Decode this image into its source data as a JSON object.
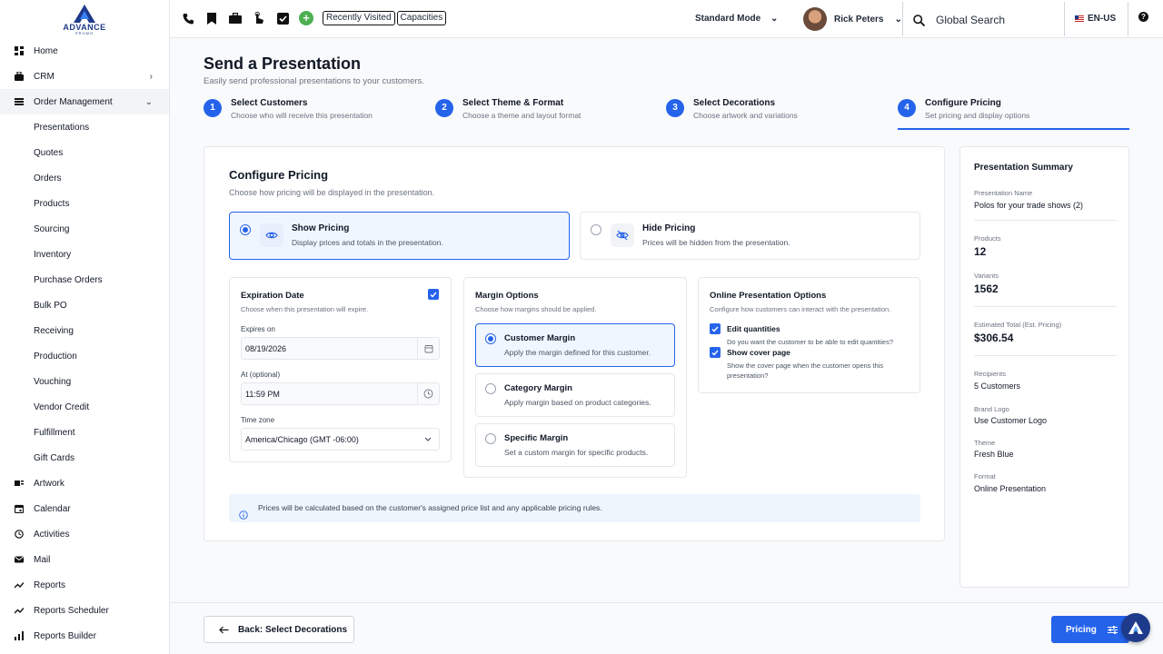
{
  "brand": {
    "logo_text": "ADVANCE",
    "logo_sub": "PROMO"
  },
  "sidebar": {
    "items": [
      {
        "label": "Home",
        "icon": "dashboard-icon"
      },
      {
        "label": "CRM",
        "icon": "briefcase-icon"
      },
      {
        "label": "Order Management",
        "icon": "list-icon"
      },
      {
        "label": "Presentations"
      },
      {
        "label": "Quotes"
      },
      {
        "label": "Orders"
      },
      {
        "label": "Products"
      },
      {
        "label": "Sourcing"
      },
      {
        "label": "Inventory"
      },
      {
        "label": "Purchase Orders"
      },
      {
        "label": "Bulk PO"
      },
      {
        "label": "Receiving"
      },
      {
        "label": "Production"
      },
      {
        "label": "Vouching"
      },
      {
        "label": "Vendor Credit"
      },
      {
        "label": "Fulfillment"
      },
      {
        "label": "Gift Cards"
      },
      {
        "label": "Artwork",
        "icon": "artwork-icon"
      },
      {
        "label": "Calendar",
        "icon": "calendar-icon"
      },
      {
        "label": "Activities",
        "icon": "clock-icon"
      },
      {
        "label": "Mail",
        "icon": "mail-icon"
      },
      {
        "label": "Reports",
        "icon": "trend-icon"
      },
      {
        "label": "Reports Scheduler",
        "icon": "trend-icon"
      },
      {
        "label": "Reports Builder",
        "icon": "bar-chart-icon"
      }
    ]
  },
  "topbar": {
    "recently_visited": "Recently Visited",
    "capacities": "Capacities",
    "mode": "Standard Mode",
    "user_name": "Rick Peters",
    "search_placeholder": "Global Search",
    "locale": "EN-US"
  },
  "page": {
    "title": "Send a Presentation",
    "subtitle": "Easily send professional presentations to your customers."
  },
  "steps": [
    {
      "num": "1",
      "title": "Select Customers",
      "desc": "Choose who will receive this presentation"
    },
    {
      "num": "2",
      "title": "Select Theme & Format",
      "desc": "Choose a theme and layout format"
    },
    {
      "num": "3",
      "title": "Select Decorations",
      "desc": "Choose artwork and variations"
    },
    {
      "num": "4",
      "title": "Configure Pricing",
      "desc": "Set pricing and display options"
    }
  ],
  "pricing": {
    "title": "Configure Pricing",
    "subtitle": "Choose how pricing will be displayed in the presentation.",
    "show": {
      "title": "Show Pricing",
      "desc": "Display prices and totals in the presentation.",
      "selected": true
    },
    "hide": {
      "title": "Hide Pricing",
      "desc": "Prices will be hidden from the presentation.",
      "selected": false
    }
  },
  "expiration": {
    "title": "Expiration Date",
    "desc": "Choose when this presentation will expire.",
    "enabled": true,
    "expires_label": "Expires on",
    "expires_value": "08/19/2026",
    "at_label": "At (optional)",
    "at_value": "11:59 PM",
    "tz_label": "Time zone",
    "tz_value": "America/Chicago (GMT -06:00)"
  },
  "margin": {
    "title": "Margin Options",
    "desc": "Choose how margins should be applied.",
    "options": [
      {
        "title": "Customer Margin",
        "desc": "Apply the margin defined for this customer.",
        "selected": true
      },
      {
        "title": "Category Margin",
        "desc": "Apply margin based on product categories.",
        "selected": false
      },
      {
        "title": "Specific Margin",
        "desc": "Set a custom margin for specific products.",
        "selected": false
      }
    ]
  },
  "online": {
    "title": "Online Presentation Options",
    "desc": "Configure how customers can interact with the presentation.",
    "edit_label": "Edit quantities",
    "edit_desc": "Do you want the customer to be able to edit quantities?",
    "edit_checked": true,
    "cover_label": "Show cover page",
    "cover_desc": "Show the cover page when the customer opens this presentation?",
    "cover_checked": true
  },
  "info_text": "Prices will be calculated based on the customer's assigned price list and any applicable pricing rules.",
  "summary": {
    "title": "Presentation Summary",
    "name_label": "Presentation Name",
    "name_value": "Polos for your trade shows (2)",
    "products_label": "Products",
    "products_value": "12",
    "variants_label": "Variants",
    "variants_value": "1562",
    "total_label": "Estimated Total (Est. Pricing)",
    "total_value": "$306.54",
    "recipients_label": "Recipients",
    "recipients_value": "5 Customers",
    "logo_label": "Brand Logo",
    "logo_value": "Use Customer Logo",
    "theme_label": "Theme",
    "theme_value": "Fresh Blue",
    "format_label": "Format",
    "format_value": "Online Presentation"
  },
  "footer": {
    "back_label": "Back: Select Decorations",
    "next_label": "Pricing"
  },
  "colors": {
    "accent": "#2563eb",
    "brand": "#1e3a8a",
    "plus": "#4caf50"
  }
}
